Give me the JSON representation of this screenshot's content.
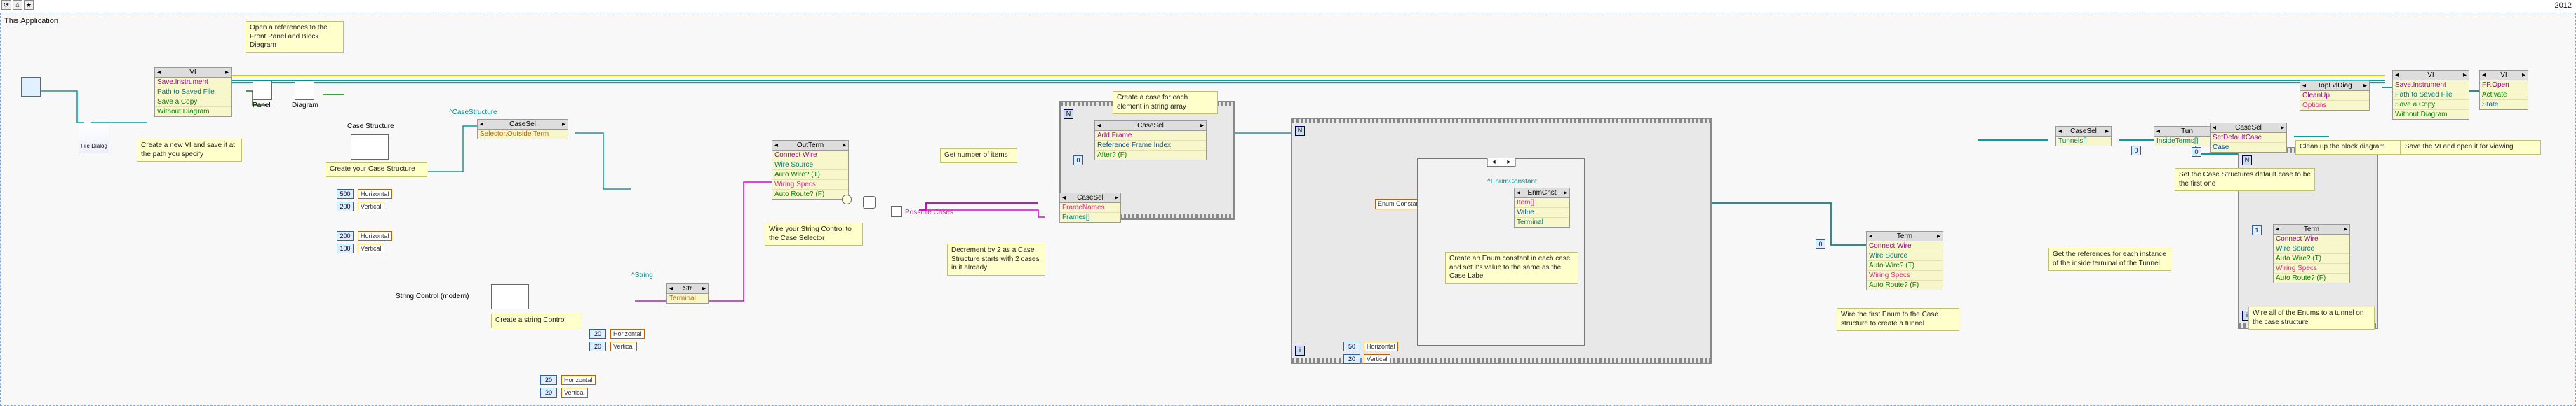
{
  "app": {
    "title": "This Application",
    "version": "2012"
  },
  "toolbar": {
    "icons": [
      "refresh",
      "home",
      "bookmark"
    ]
  },
  "comments": {
    "open_refs": "Open a references to\nthe Front Panel and\nBlock Diagram",
    "new_vi": "Create a new VI and save\nit at the path you specify",
    "create_case": "Create your Case Structure",
    "create_string_ctl": "Create a string Control",
    "wire_string": "Wire your String Control\nto the Case Selector",
    "get_items": "Get number of items",
    "decrement": "Decrement by 2 as\na Case Structure starts\nwith 2 cases in it already",
    "case_per_elem": "Create a case for each\nelement in string array",
    "enum_each": "Create an Enum constant in each\ncase and set it's value to the same\nas the Case Label",
    "wire_enum": "Wire the first Enum to the\nCase structure to create a tunnel",
    "get_refs_inside": "Get the references for each\ninstance of the inside terminal\nof the Tunnel",
    "set_default": "Set the Case Structures default case\nto be the first one",
    "cleanup": "Clean up the block diagram",
    "save_open": "Save the VI and open it for viewing",
    "wire_enums_tunnel": "Wire all of the Enums to a tunnel\non the case structure",
    "possible_cases": "Possible Cases"
  },
  "nodes": {
    "file_dialog": "File Dialog",
    "vi1": {
      "header": "VI",
      "rows": [
        "Save.Instrument",
        "Path to Saved File",
        "Save a Copy",
        "Without Diagram"
      ]
    },
    "panel_icon": "Panel",
    "diagram_icon": "Diagram",
    "case_structure_label": "Case Structure",
    "casestructure_type": "^CaseStructure",
    "casesel1": {
      "header": "CaseSel",
      "rows": [
        "Selector.Outside Term"
      ]
    },
    "string_ctl_label": "String Control (modern)",
    "string_type": "^String",
    "str_node": {
      "header": "Str",
      "rows": [
        "Terminal"
      ]
    },
    "outterm": {
      "header": "OutTerm",
      "rows": [
        "Connect Wire",
        "Wire Source",
        "Auto Wire? (T)",
        "Wiring Specs",
        "Auto Route? (F)"
      ]
    },
    "hv1": "Horizontal",
    "vv1": "Vertical",
    "hv2": "Horizontal",
    "vv2": "Vertical",
    "hv3": "Horizontal",
    "vv3": "Vertical",
    "hv5": "Horizontal",
    "vv5": "Vertical",
    "enum_constant": "Enum Constant ▾",
    "framenames": "FrameNames",
    "framesidx": "Frames[]",
    "casesel2_add": {
      "header": "CaseSel",
      "rows": [
        "Add Frame",
        "Reference Frame Index",
        "After? (F)"
      ]
    },
    "enmcnst_type": "^EnumConstant",
    "enmcnst": {
      "header": "EnmCnst",
      "rows": [
        "Item[]",
        "Value",
        "Terminal"
      ]
    },
    "term1": {
      "header": "Term",
      "rows": [
        "Connect Wire",
        "Wire Source",
        "Auto Wire? (T)",
        "Wiring Specs",
        "Auto Route? (F)"
      ]
    },
    "casesel_tunnels": {
      "header": "CaseSel",
      "rows": [
        "Tunnels[]"
      ]
    },
    "tun": {
      "header": "Tun",
      "rows": [
        "InsideTerms[]"
      ]
    },
    "term2": {
      "header": "Term",
      "rows": [
        "Connect Wire",
        "Wire Source",
        "Auto Wire? (T)",
        "Wiring Specs",
        "Auto Route? (F)"
      ]
    },
    "casesel_default": {
      "header": "CaseSel",
      "rows": [
        "SetDefaultCase",
        "Case"
      ]
    },
    "toplvl": {
      "header": "TopLvlDiag",
      "rows": [
        "CleanUp",
        "Options"
      ]
    },
    "vi2": {
      "header": "VI",
      "rows": [
        "Save.Instrument",
        "Path to Saved File",
        "Save a Copy",
        "Without Diagram"
      ]
    },
    "vi3": {
      "header": "VI",
      "rows": [
        "FP.Open",
        "Activate",
        "State"
      ]
    }
  },
  "numbers": {
    "a": "500",
    "b": "200",
    "c": "200",
    "d": "100",
    "e": "20",
    "f": "20",
    "g": "50",
    "h": "20",
    "zero": "0",
    "one": "1",
    "i": "i"
  },
  "labels": {
    "for_n": "N",
    "for_n2": "N",
    "index_i": "i",
    "arrow_left": "◂",
    "arrow_right": "▸",
    "dropdown_arrow": "▾"
  }
}
